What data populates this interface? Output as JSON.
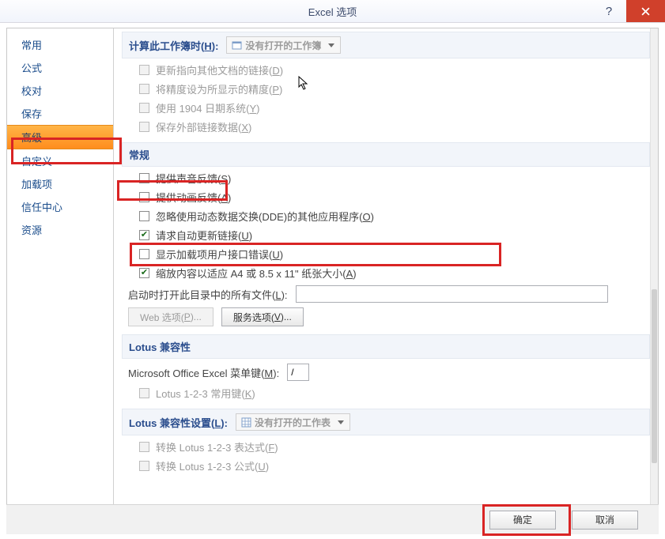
{
  "title": "Excel 选项",
  "sidebar": {
    "items": [
      {
        "label": "常用"
      },
      {
        "label": "公式"
      },
      {
        "label": "校对"
      },
      {
        "label": "保存"
      },
      {
        "label": "高级",
        "active": true
      },
      {
        "label": "自定义"
      },
      {
        "label": "加载项"
      },
      {
        "label": "信任中心"
      },
      {
        "label": "资源"
      }
    ]
  },
  "calc": {
    "head_prefix": "计算此工作簿时(",
    "head_key": "H",
    "head_suffix": "):",
    "combo": "没有打开的工作簿",
    "c1_pre": "更新指向其他文档的链接(",
    "c1_k": "D",
    "c1_suf": ")",
    "c2_pre": "将精度设为所显示的精度(",
    "c2_k": "P",
    "c2_suf": ")",
    "c3_pre": "使用 1904 日期系统(",
    "c3_k": "Y",
    "c3_suf": ")",
    "c4_pre": "保存外部链接数据(",
    "c4_k": "X",
    "c4_suf": ")"
  },
  "general": {
    "head": "常规",
    "c1_pre": "提供声音反馈(",
    "c1_k": "S",
    "c1_suf": ")",
    "c2_pre": "提供动画反馈(",
    "c2_k": "A",
    "c2_suf": ")",
    "c3_pre": "忽略使用动态数据交换(DDE)的其他应用程序(",
    "c3_k": "O",
    "c3_suf": ")",
    "c4_pre": "请求自动更新链接(",
    "c4_k": "U",
    "c4_suf": ")",
    "c5_pre": "显示加载项用户接口错误(",
    "c5_k": "U",
    "c5_suf": ")",
    "c6_pre": "缩放内容以适应 A4 或 8.5 x 11\" 纸张大小(",
    "c6_k": "A",
    "c6_suf": ")",
    "startlbl_pre": "启动时打开此目录中的所有文件(",
    "startlbl_k": "L",
    "startlbl_suf": "):",
    "webbtn_pre": "Web 选项(",
    "webbtn_k": "P",
    "webbtn_suf": ")...",
    "svcbtn_pre": "服务选项(",
    "svcbtn_k": "V",
    "svcbtn_suf": ")..."
  },
  "lotus1": {
    "head": "Lotus 兼容性",
    "menukey_pre": "Microsoft Office Excel 菜单键(",
    "menukey_k": "M",
    "menukey_suf": "):",
    "menukey_val": "/",
    "c1_pre": "Lotus 1-2-3 常用键(",
    "c1_k": "K",
    "c1_suf": ")"
  },
  "lotus2": {
    "head_pre": "Lotus 兼容性设置(",
    "head_k": "L",
    "head_suf": "):",
    "combo": "没有打开的工作表",
    "c1_pre": "转换 Lotus 1-2-3 表达式(",
    "c1_k": "F",
    "c1_suf": ")",
    "c2_pre": "转换 Lotus 1-2-3 公式(",
    "c2_k": "U",
    "c2_suf": ")"
  },
  "footer": {
    "ok": "确定",
    "cancel": "取消"
  },
  "help_symbol": "?"
}
